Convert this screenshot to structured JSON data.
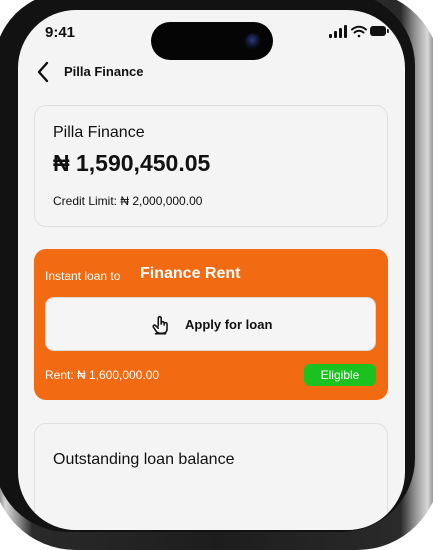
{
  "status_bar": {
    "time": "9:41"
  },
  "nav": {
    "title": "Pilla Finance"
  },
  "balance_card": {
    "title": "Pilla Finance",
    "amount": "₦ 1,590,450.05",
    "credit_limit": "Credit Limit: ₦ 2,000,000.00"
  },
  "loan_card": {
    "prefix": "Instant loan to",
    "highlight": "Finance Rent",
    "apply_label": "Apply for loan",
    "rent": "Rent: ₦ 1,600,000.00",
    "badge": "Eligible"
  },
  "outstanding_card": {
    "title": "Outstanding loan balance"
  },
  "colors": {
    "accent": "#f26a12",
    "eligible": "#1bc21f",
    "background": "#f4f4f4"
  },
  "icons": [
    "chevron-left-icon",
    "tap-hand-icon",
    "signal-icon",
    "wifi-icon",
    "battery-icon"
  ]
}
